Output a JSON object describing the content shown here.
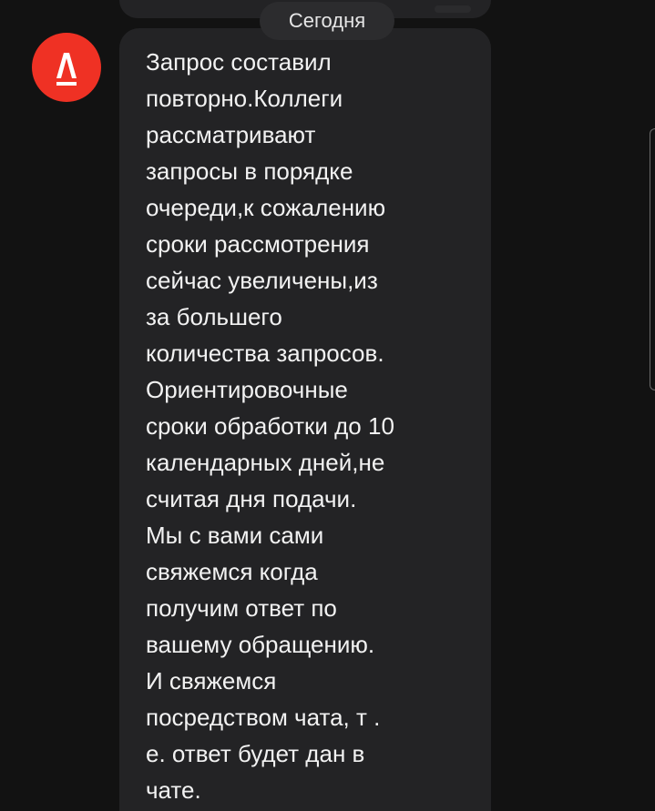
{
  "date_separator": "Сегодня",
  "sender": {
    "avatar_letter": "А",
    "avatar_color": "#ef3124"
  },
  "message": {
    "lines": [
      "Запрос составил",
      "повторно.Коллеги",
      "рассматривают",
      "запросы в порядке",
      "очереди,к сожалению",
      "сроки рассмотрения",
      "сейчас увеличены,из",
      "за большего",
      "количества запросов.",
      "Ориентировочные",
      "сроки обработки до 10",
      "календарных дней,не",
      "считая дня подачи.",
      "Мы с вами сами",
      "свяжемся когда",
      "получим ответ по",
      "вашему обращению.",
      "И свяжемся",
      "посредством чата, т .",
      "е. ответ будет дан в",
      "чате."
    ]
  },
  "colors": {
    "background": "#121212",
    "bubble": "#232325",
    "date_pill": "#2c2c2e",
    "text": "#f2f2f2"
  }
}
